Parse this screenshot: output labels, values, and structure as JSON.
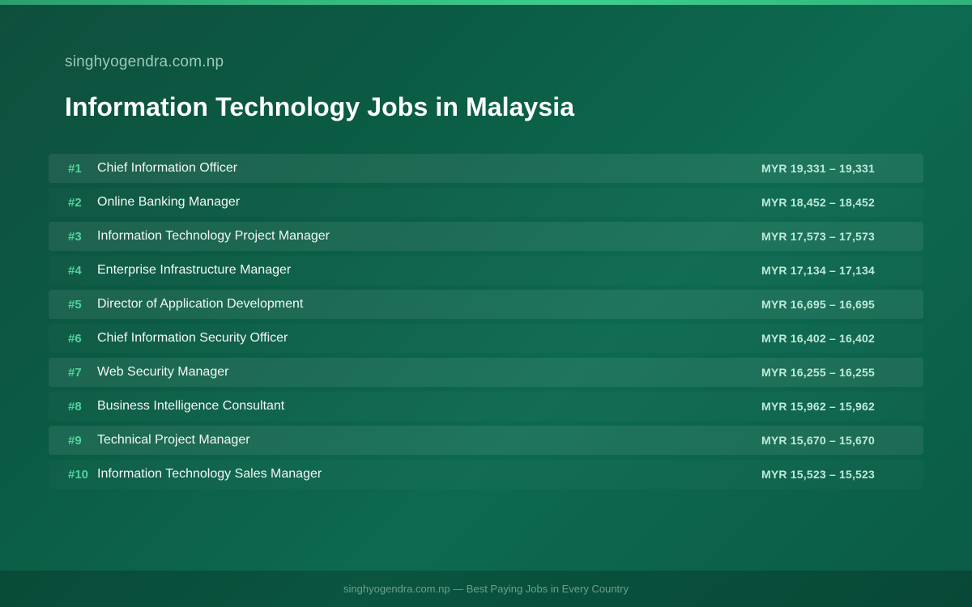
{
  "header": {
    "site_name": "singhyogendra.com.np",
    "title": "Information Technology Jobs in Malaysia"
  },
  "jobs": [
    {
      "rank": "#1",
      "title": "Chief Information Officer",
      "salary": "MYR 19,331 – 19,331"
    },
    {
      "rank": "#2",
      "title": "Online Banking Manager",
      "salary": "MYR 18,452 – 18,452"
    },
    {
      "rank": "#3",
      "title": "Information Technology Project Manager",
      "salary": "MYR 17,573 – 17,573"
    },
    {
      "rank": "#4",
      "title": "Enterprise Infrastructure Manager",
      "salary": "MYR 17,134 – 17,134"
    },
    {
      "rank": "#5",
      "title": "Director of Application Development",
      "salary": "MYR 16,695 – 16,695"
    },
    {
      "rank": "#6",
      "title": "Chief Information Security Officer",
      "salary": "MYR 16,402 – 16,402"
    },
    {
      "rank": "#7",
      "title": "Web Security Manager",
      "salary": "MYR 16,255 – 16,255"
    },
    {
      "rank": "#8",
      "title": "Business Intelligence Consultant",
      "salary": "MYR 15,962 – 15,962"
    },
    {
      "rank": "#9",
      "title": "Technical Project Manager",
      "salary": "MYR 15,670 – 15,670"
    },
    {
      "rank": "#10",
      "title": "Information Technology Sales Manager",
      "salary": "MYR 15,523 – 15,523"
    }
  ],
  "footer": {
    "text": "singhyogendra.com.np — Best Paying Jobs in Every Country"
  },
  "colors": {
    "accent": "#4fd39c",
    "background": "#0b5b44"
  }
}
